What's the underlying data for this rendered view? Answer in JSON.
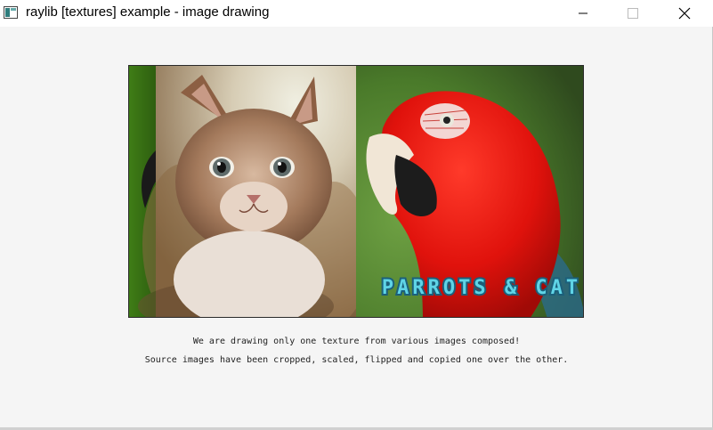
{
  "window": {
    "title": "raylib [textures] example - image drawing"
  },
  "image": {
    "overlay_text": "PARROTS & CAT",
    "overlay_color": "#5fd4e6"
  },
  "captions": {
    "line1": "We are drawing only one texture from various images composed!",
    "line2": "Source images have been cropped, scaled, flipped and copied one over the other."
  },
  "icons": {
    "app": "app-window-icon",
    "minimize": "minimize-icon",
    "maximize": "maximize-icon",
    "close": "close-icon"
  }
}
